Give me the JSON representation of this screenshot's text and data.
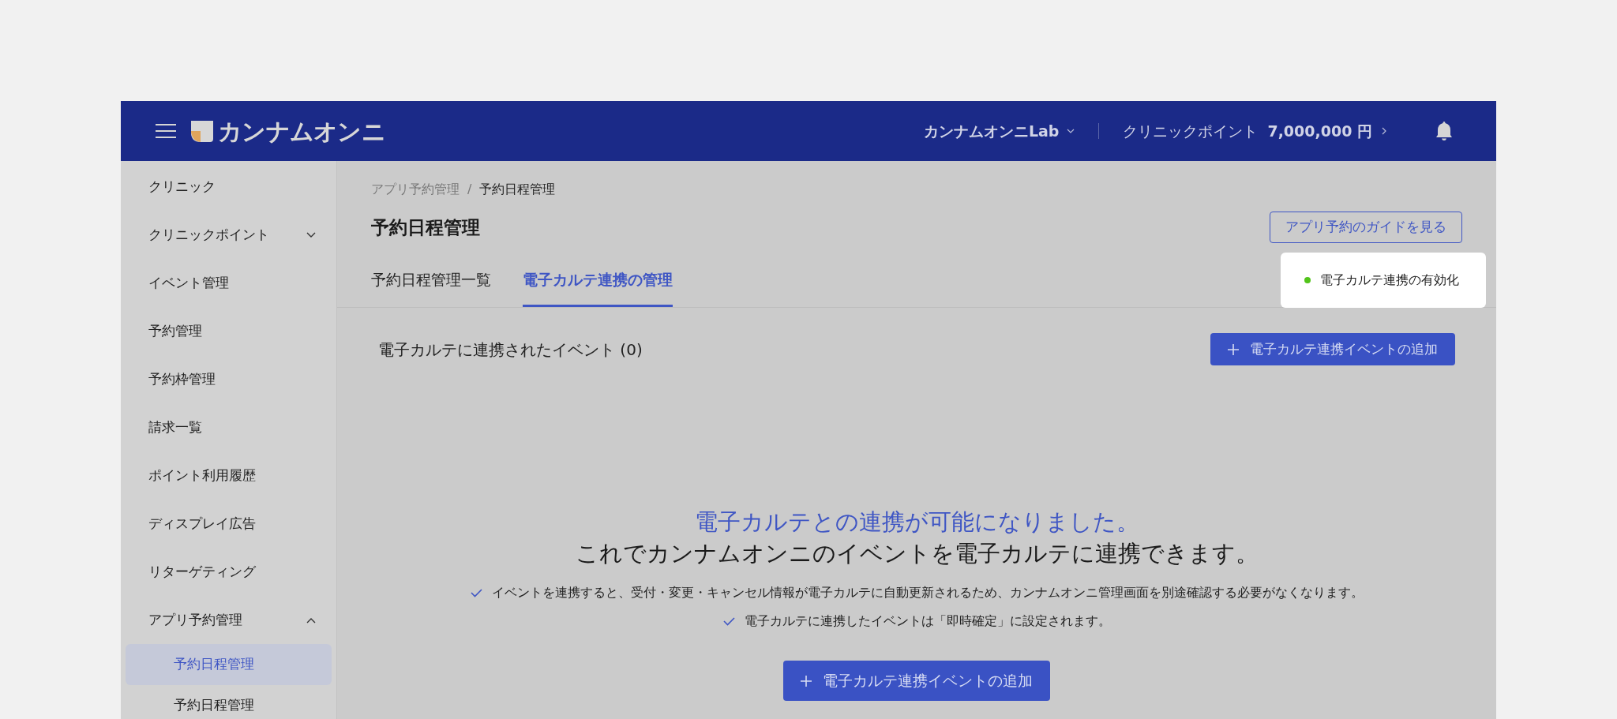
{
  "header": {
    "brand": "カンナムオンニ",
    "account": "カンナムオンニLab",
    "points_label": "クリニックポイント",
    "points_value": "7,000,000 円"
  },
  "sidebar": {
    "items": [
      {
        "label": "クリニック",
        "selected": false
      },
      {
        "label": "クリニックポイント",
        "selected": false,
        "expanded": false
      },
      {
        "label": "イベント管理",
        "selected": false
      },
      {
        "label": "予約管理",
        "selected": false
      },
      {
        "label": "予約枠管理",
        "selected": false
      },
      {
        "label": "請求一覧",
        "selected": false
      },
      {
        "label": "ポイント利用履歴",
        "selected": false
      },
      {
        "label": "ディスプレイ広告",
        "selected": false
      },
      {
        "label": "リターゲティング",
        "selected": false
      },
      {
        "label": "アプリ予約管理",
        "selected": false,
        "expanded": true,
        "children": [
          {
            "label": "予約日程管理",
            "selected": true
          },
          {
            "label": "予約日程管理",
            "selected": false
          }
        ]
      }
    ]
  },
  "breadcrumb": [
    "アプリ予約管理",
    "/",
    "予約日程管理"
  ],
  "page_title": "予約日程管理",
  "guide_button": "アプリ予約のガイドを見る",
  "tabs": [
    {
      "label": "予約日程管理一覧",
      "selected": false
    },
    {
      "label": "電子カルテ連携の管理",
      "selected": true
    }
  ],
  "integration_toggle": {
    "label": "電子カルテ連携の有効化",
    "on": true
  },
  "events_section": {
    "title": "電子カルテに連携されたイベント (0)",
    "add_button": "電子カルテ連携イベントの追加"
  },
  "empty_state": {
    "headline": "電子カルテとの連携が可能になりました。",
    "subline": "これでカンナムオンニのイベントを電子カルテに連携できます。",
    "bullets": [
      "イベントを連携すると、受付・変更・キャンセル情報が電子カルテに自動更新されるため、カンナムオンニ管理画面を別途確認する必要がなくなります。",
      "電子カルテに連携したイベントは「即時確定」に設定されます。"
    ],
    "button": "電子カルテ連携イベントの追加"
  }
}
